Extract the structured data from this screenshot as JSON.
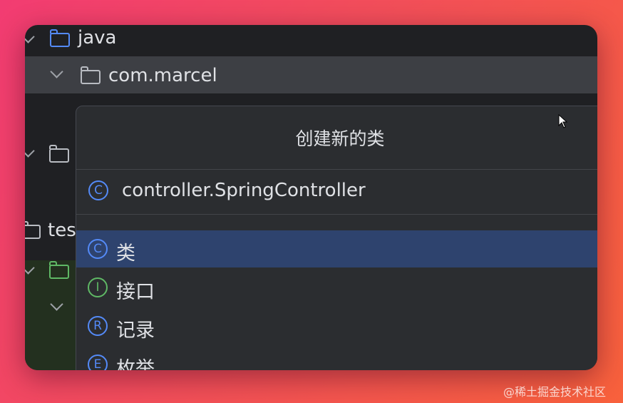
{
  "project_tree": {
    "items": [
      {
        "label": "java",
        "icon": "folder-icon"
      },
      {
        "label": "com.marcel",
        "icon": "package-icon"
      },
      {
        "label": "",
        "icon": "resources-folder-icon"
      },
      {
        "label": "tes",
        "icon": "folder-icon"
      },
      {
        "label": "",
        "icon": "test-folder-icon"
      }
    ]
  },
  "dialog": {
    "title": "创建新的类",
    "name_input": "controller.SpringController",
    "name_icon": "C",
    "kinds": [
      {
        "letter": "C",
        "label": "类",
        "selected": true
      },
      {
        "letter": "I",
        "label": "接口",
        "selected": false
      },
      {
        "letter": "R",
        "label": "记录",
        "selected": false
      },
      {
        "letter": "E",
        "label": "枚举",
        "selected": false
      }
    ]
  },
  "watermark": "@稀土掘金技术社区",
  "colors": {
    "selection_blue": "#2e436e",
    "tree_selection": "#3d3f44",
    "class_icon_blue": "#548af7",
    "interface_icon_green": "#5fb865",
    "background_gradient_start": "#f23c72",
    "background_gradient_end": "#f8613c"
  }
}
